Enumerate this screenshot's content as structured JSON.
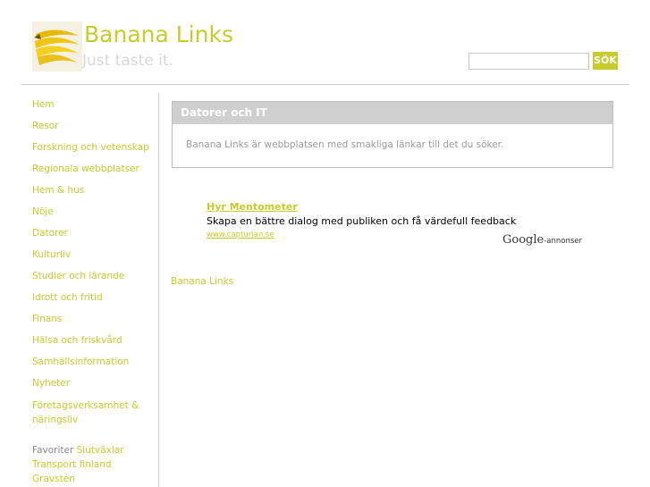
{
  "header": {
    "title": "Banana Links",
    "slogan": "Just taste it."
  },
  "search": {
    "button_label": "SÖK",
    "value": ""
  },
  "sidebar": {
    "items": [
      {
        "label": "Hem"
      },
      {
        "label": "Resor"
      },
      {
        "label": "Forskning och vetenskap"
      },
      {
        "label": "Regionala webbplatser"
      },
      {
        "label": "Hem & hus"
      },
      {
        "label": "Nöje"
      },
      {
        "label": "Datorer"
      },
      {
        "label": "Kulturliv"
      },
      {
        "label": "Studier och lärande"
      },
      {
        "label": "Idrott och fritid"
      },
      {
        "label": "Finans"
      },
      {
        "label": "Hälsa och friskvård"
      },
      {
        "label": "Samhällsinformation"
      },
      {
        "label": "Nyheter"
      },
      {
        "label": "Företagsverksamhet & näringsliv"
      }
    ],
    "favoriter_label": "Favoriter",
    "favoriter_links": [
      "Slutväxlar",
      "Transport finland",
      "Gravsten"
    ]
  },
  "main": {
    "box_title": "Datorer och IT",
    "box_text": "Banana Links är webbplatsen med smakliga länkar till det du söker."
  },
  "ad": {
    "title": "Hyr Mentometer",
    "description": "Skapa en bättre dialog med publiken och få värdefull feedback",
    "url": "www.capturian.se",
    "badge_brand": "Google",
    "badge_suffix": "-annonser"
  },
  "footer": {
    "link_label": "Banana Links"
  },
  "colors": {
    "accent": "#c5cc2c",
    "divider": "#cfcfcf"
  }
}
